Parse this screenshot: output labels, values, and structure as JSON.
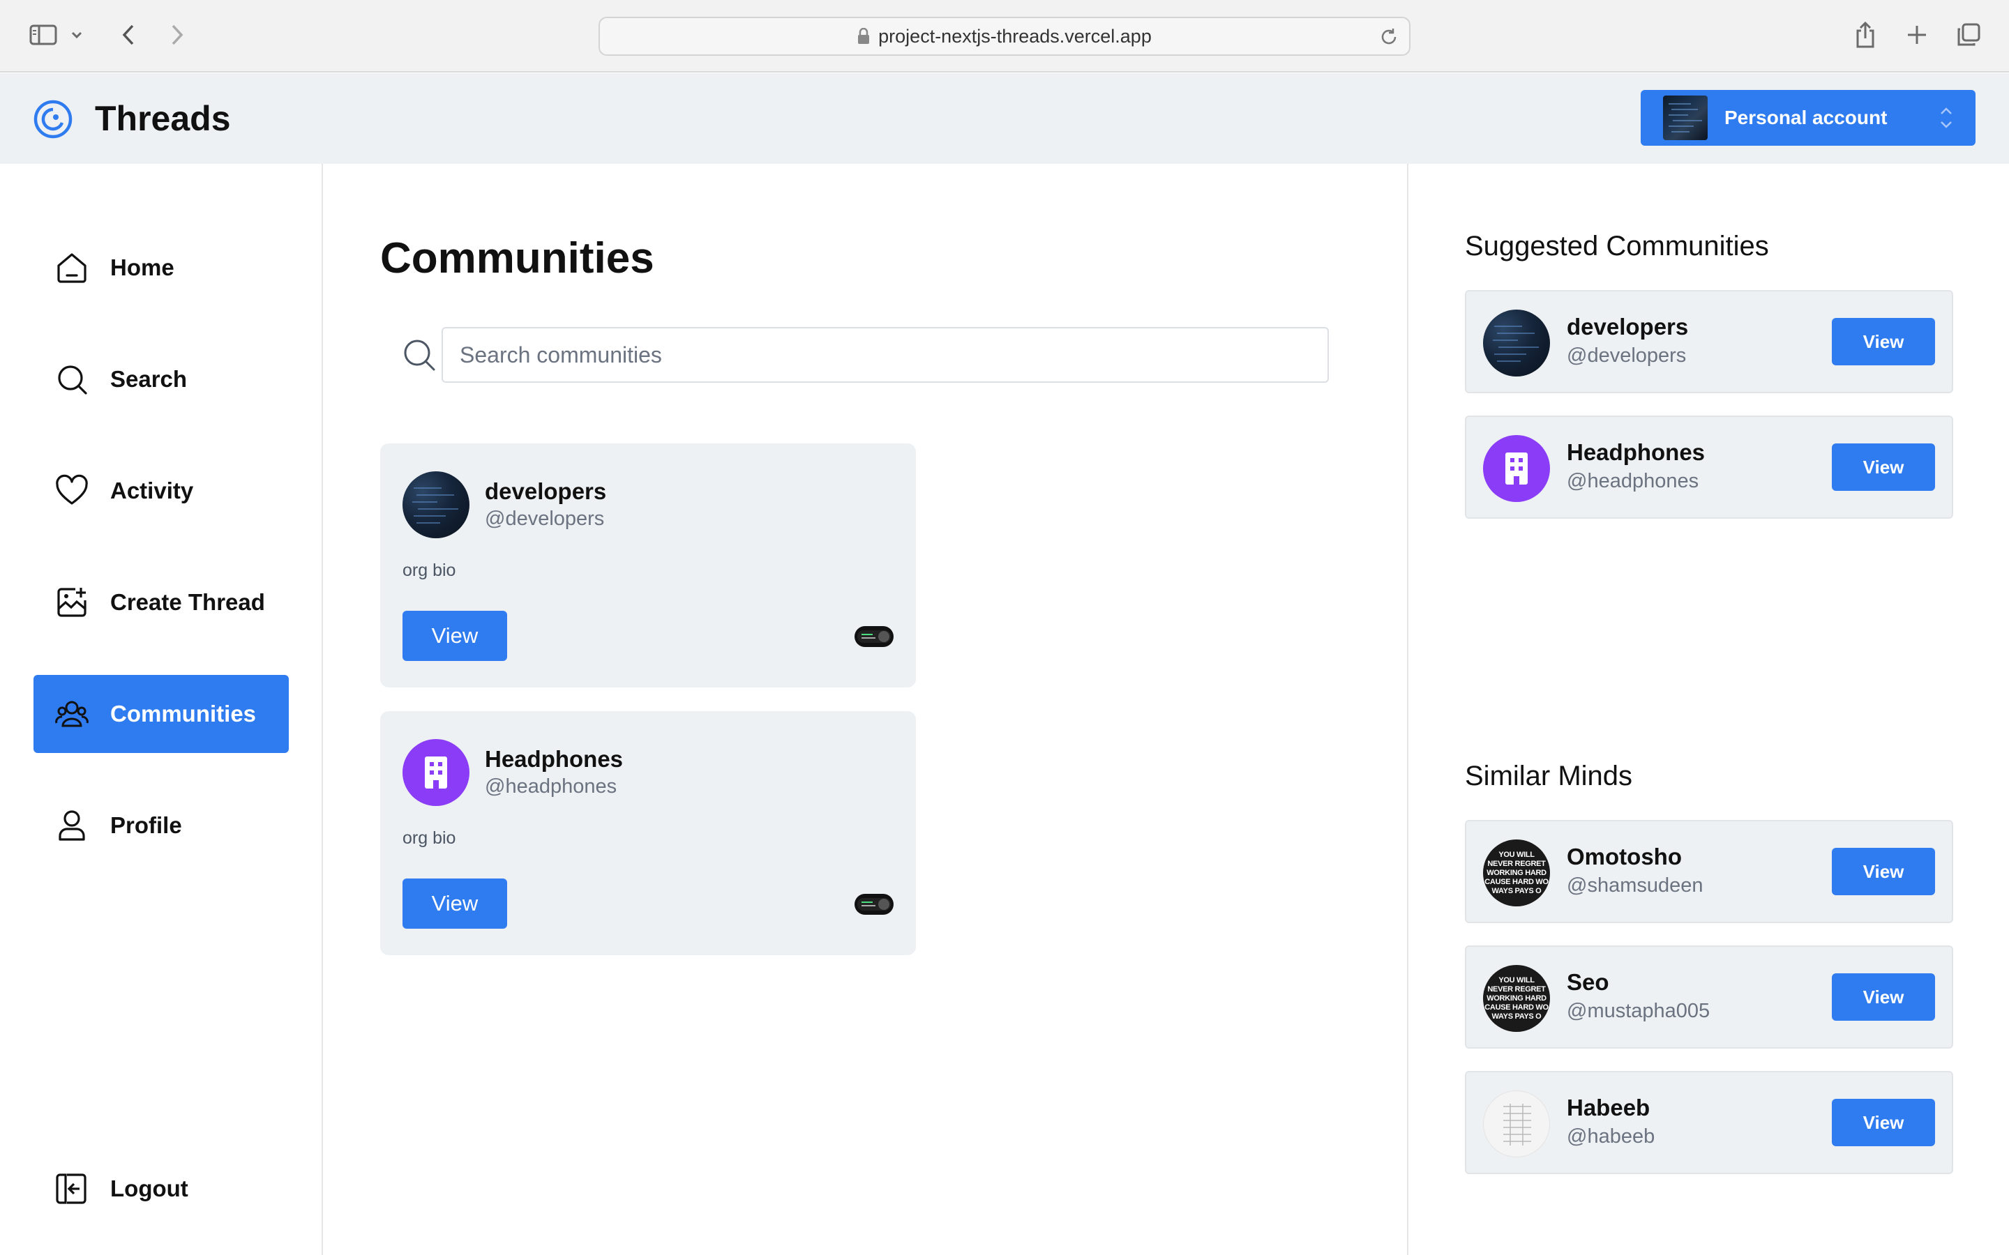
{
  "browser": {
    "url": "project-nextjs-threads.vercel.app"
  },
  "header": {
    "app_title": "Threads",
    "account_label": "Personal account"
  },
  "sidebar": {
    "items": [
      {
        "label": "Home",
        "icon": "home-icon"
      },
      {
        "label": "Search",
        "icon": "search-icon"
      },
      {
        "label": "Activity",
        "icon": "heart-icon"
      },
      {
        "label": "Create Thread",
        "icon": "create-thread-icon"
      },
      {
        "label": "Communities",
        "icon": "communities-icon",
        "active": true
      },
      {
        "label": "Profile",
        "icon": "profile-icon"
      }
    ],
    "logout_label": "Logout"
  },
  "main": {
    "title": "Communities",
    "search_placeholder": "Search communities",
    "communities": [
      {
        "name": "developers",
        "handle": "@developers",
        "bio": "org bio",
        "button": "View"
      },
      {
        "name": "Headphones",
        "handle": "@headphones",
        "bio": "org bio",
        "button": "View"
      }
    ]
  },
  "right": {
    "suggested_title": "Suggested Communities",
    "suggested": [
      {
        "name": "developers",
        "handle": "@developers",
        "button": "View"
      },
      {
        "name": "Headphones",
        "handle": "@headphones",
        "button": "View"
      }
    ],
    "similar_title": "Similar Minds",
    "similar": [
      {
        "name": "Omotosho",
        "handle": "@shamsudeen",
        "button": "View"
      },
      {
        "name": "Seo",
        "handle": "@mustapha005",
        "button": "View"
      },
      {
        "name": "Habeeb",
        "handle": "@habeeb",
        "button": "View"
      }
    ],
    "avatar_text_lines": [
      "YOU WILL",
      "NEVER REGRET",
      "WORKING HARD",
      "CAUSE HARD WO",
      "WAYS PAYS O"
    ]
  },
  "colors": {
    "accent": "#2f7bf0",
    "header_bg": "#eef1f3",
    "card_bg": "#eef1f3",
    "headphones_avatar": "#8b3cf6"
  }
}
